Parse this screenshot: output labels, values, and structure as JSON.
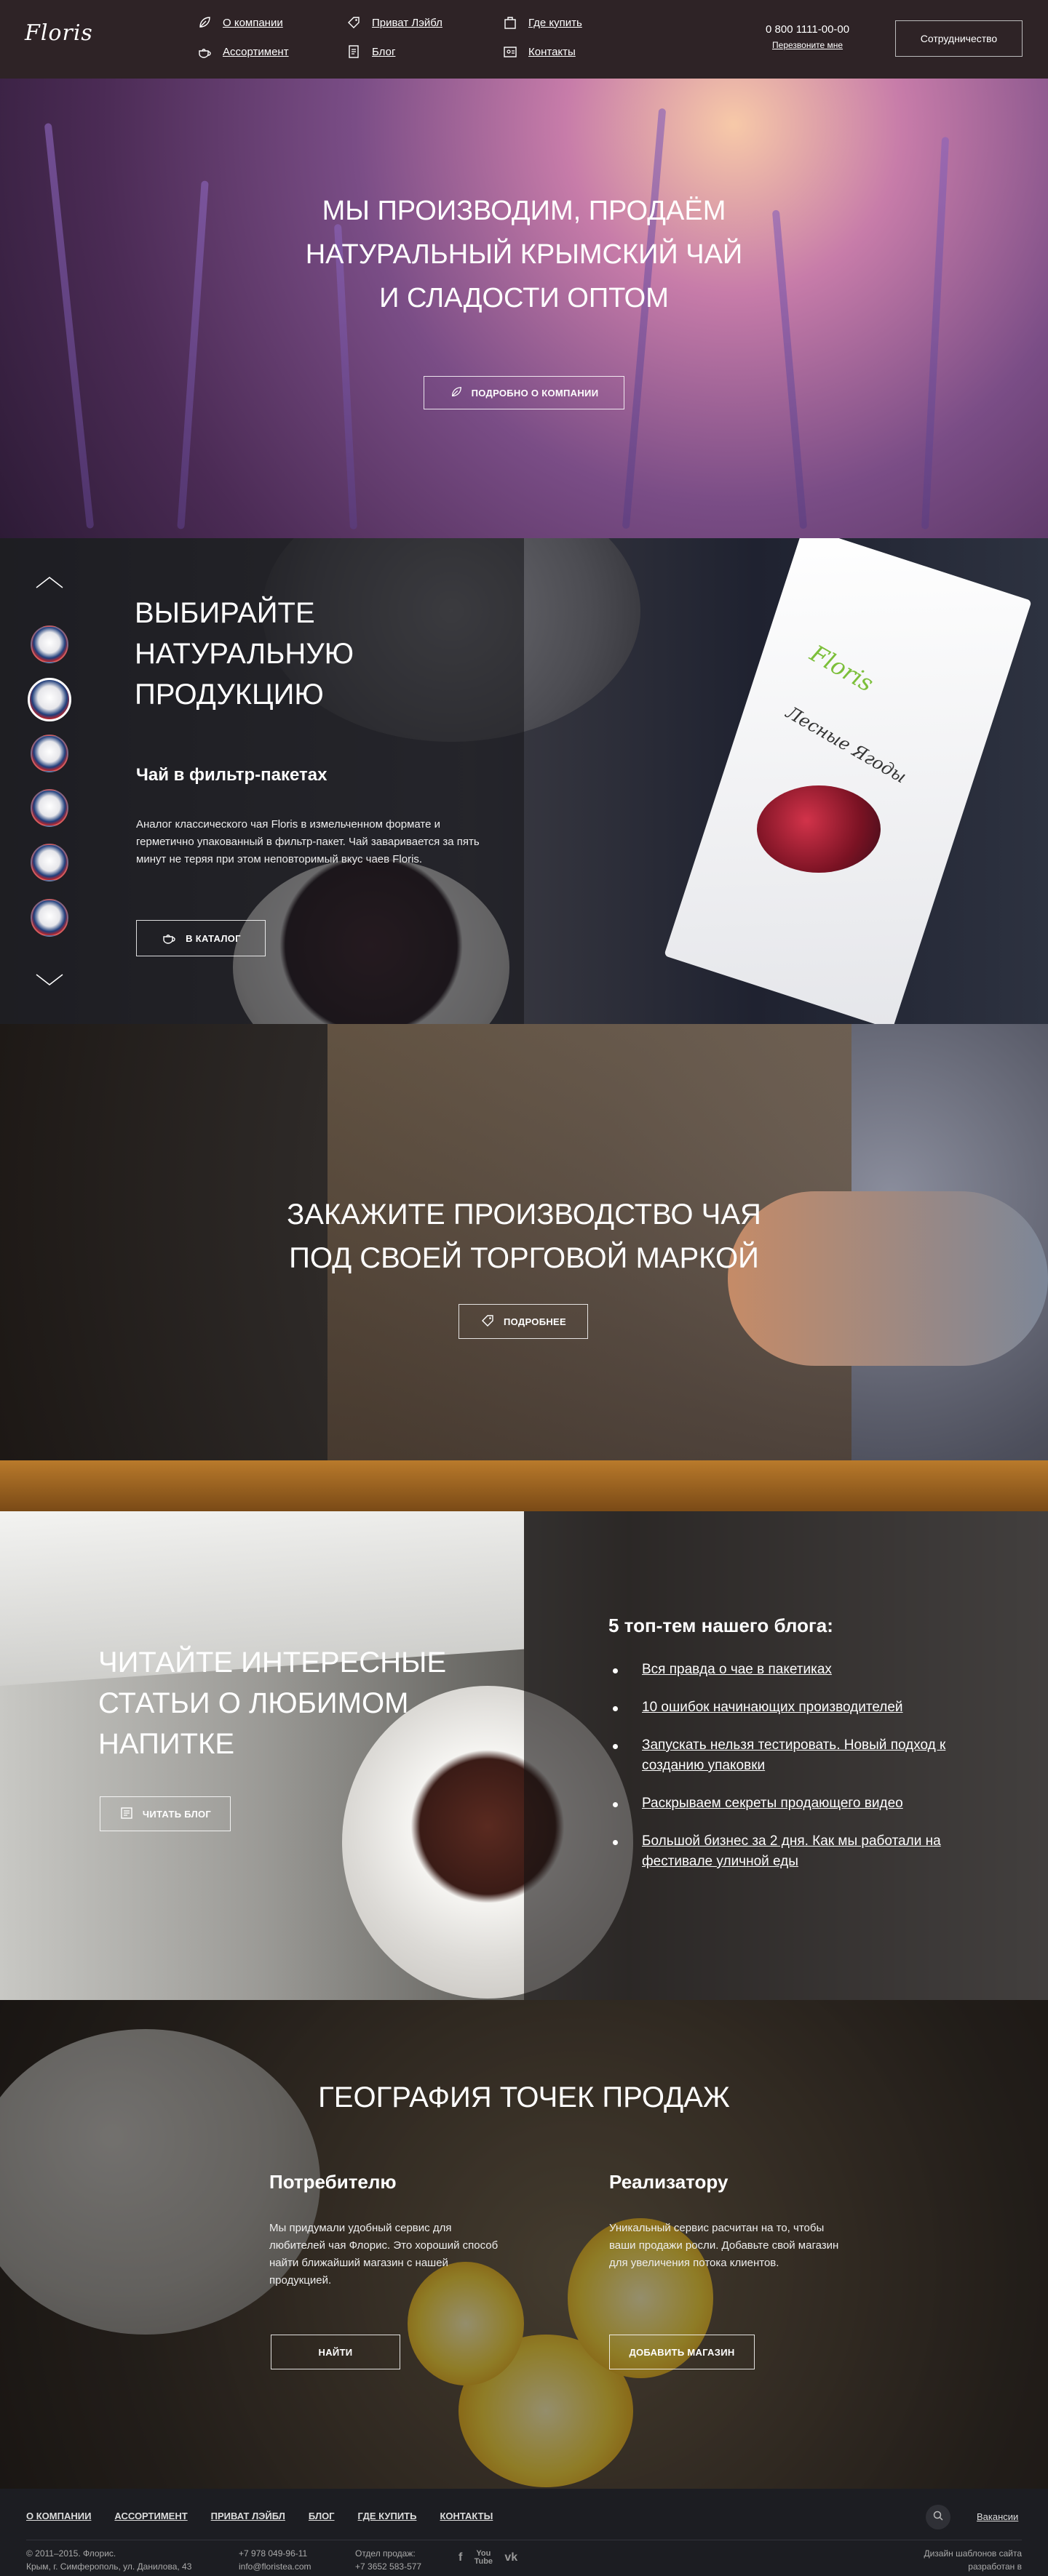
{
  "header": {
    "logo": "Floris",
    "nav": [
      {
        "label": "О компании",
        "icon": "leaf-icon"
      },
      {
        "label": "Приват Лэйбл",
        "icon": "tag-icon"
      },
      {
        "label": "Где купить",
        "icon": "shop-icon"
      },
      {
        "label": "Ассортимент",
        "icon": "teapot-icon"
      },
      {
        "label": "Блог",
        "icon": "document-icon"
      },
      {
        "label": "Контакты",
        "icon": "address-card-icon"
      }
    ],
    "phone": "0 800 1111-00-00",
    "callback": "Перезвоните мне",
    "partner_button": "Сотрудничество"
  },
  "hero": {
    "title_lines": [
      "МЫ ПРОИЗВОДИМ, ПРОДАЁМ",
      "НАТУРАЛЬНЫЙ КРЫМСКИЙ ЧАЙ",
      "И СЛАДОСТИ ОПТОМ"
    ],
    "button": "ПОДРОБНО О КОМПАНИИ"
  },
  "products": {
    "title_lines": [
      "ВЫБИРАЙТЕ",
      "НАТУРАЛЬНУЮ",
      "ПРОДУКЦИЮ"
    ],
    "subtitle": "Чай в фильтр-пакетах",
    "text": "Аналог классического чая Floris в измельченном формате и герметично упакованный в фильтр-пакет. Чай заваривается за пять минут не теряя при этом неповторимый вкус чаев Floris.",
    "button": "В КАТАЛОГ",
    "pack_brand": "Floris",
    "pack_name": "Лесные Ягоды"
  },
  "private_label": {
    "title_lines": [
      "ЗАКАЖИТЕ ПРОИЗВОДСТВО ЧАЯ",
      "ПОД СВОЕЙ ТОРГОВОЙ МАРКОЙ"
    ],
    "button": "ПОДРОБНЕЕ"
  },
  "blog": {
    "title_lines": [
      "ЧИТАЙТЕ ИНТЕРЕСНЫЕ",
      "СТАТЬИ О ЛЮБИМОМ",
      "НАПИТКЕ"
    ],
    "button": "ЧИТАТЬ БЛОГ",
    "list_title": "5 топ-тем нашего блога:",
    "topics": [
      "Вся правда о чае в пакетиках",
      "10 ошибок начинающих производителей",
      "Запускать нельзя тестировать. Новый подход к созданию упаковки",
      "Раскрываем секреты продающего видео",
      "Большой бизнес за 2 дня. Как мы работали на фестивале уличной еды"
    ]
  },
  "geo": {
    "title": "ГЕОГРАФИЯ ТОЧЕК ПРОДАЖ",
    "consumer": {
      "title": "Потребителю",
      "text": "Мы придумали удобный сервис для любителей чая Флорис. Это хороший способ найти ближайший магазин с нашей продукцией.",
      "button": "НАЙТИ"
    },
    "seller": {
      "title": "Реализатору",
      "text": "Уникальный сервис расчитан на то, чтобы ваши продажи росли. Добавьте свой магазин для увеличения потока клиентов.",
      "button": "ДОБАВИТЬ МАГАЗИН"
    }
  },
  "footer": {
    "nav": [
      "О КОМПАНИИ",
      "АССОРТИМЕНТ",
      "ПРИВАТ ЛЭЙБЛ",
      "БЛОГ",
      "ГДЕ КУПИТЬ",
      "КОНТАКТЫ"
    ],
    "vacancies": "Вакансии",
    "copyright": "© 2011–2015. Флорис.",
    "address": "Крым, г. Симферополь, ул. Данилова, 43",
    "phone1": "+7 978 049-96-11",
    "email": "info@floristea.com",
    "sales_label": "Отдел продаж:",
    "sales_phone": "+7 3652 583-577",
    "social": [
      "f",
      "You Tube",
      "vk"
    ],
    "dev1": "Дизайн шаблонов сайта",
    "dev2": "разработан в"
  },
  "colors": {
    "header_bg": "#2e2326",
    "footer_bg": "#1c1d22",
    "text_light": "#ffffff"
  }
}
